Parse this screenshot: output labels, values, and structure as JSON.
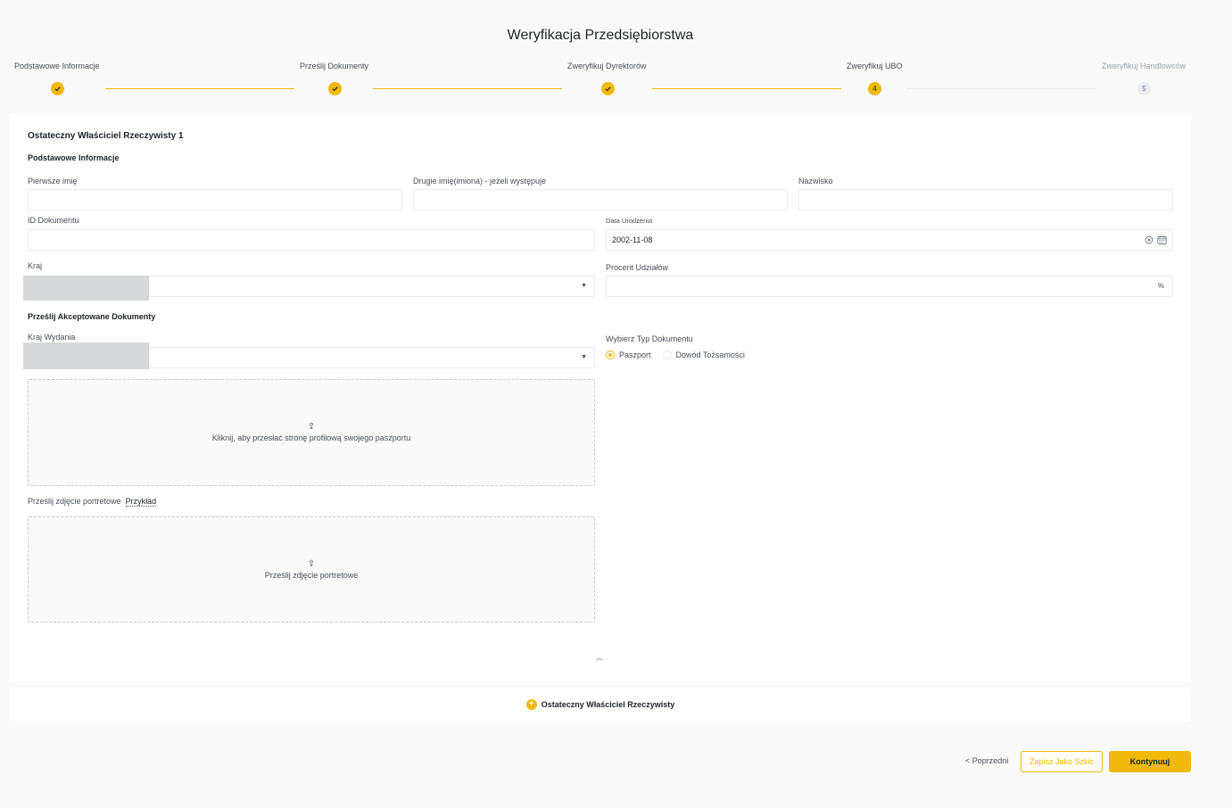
{
  "page": {
    "title": "Weryfikacja Przedsiębiorstwa"
  },
  "stepper": {
    "steps": [
      {
        "label": "Podstawowe Informacje",
        "state": "done"
      },
      {
        "label": "Prześlij Dokumenty",
        "state": "done"
      },
      {
        "label": "Zweryfikuj Dyrektorów",
        "state": "done"
      },
      {
        "label": "Zweryfikuj UBO",
        "state": "current",
        "number": "4"
      },
      {
        "label": "Zweryfikuj Handlowców",
        "state": "pending",
        "number": "5"
      }
    ]
  },
  "ubo": {
    "title": "Ostateczny Właściciel Rzeczywisty 1",
    "basic_section": "Podstawowe Informacje",
    "first_name": {
      "label": "Pierwsze imię",
      "value": ""
    },
    "middle_name": {
      "label": "Drugie imię(imiona) - jeżeli występuje",
      "value": ""
    },
    "last_name": {
      "label": "Nazwisko",
      "value": ""
    },
    "document_id": {
      "label": "ID Dokumentu",
      "value": ""
    },
    "birth_date": {
      "label": "Data Urodzenia",
      "value": "2002-11-08"
    },
    "country": {
      "label": "Kraj",
      "value": ""
    },
    "share_percent": {
      "label": "Procent Udziałów",
      "value": "",
      "suffix": "%"
    },
    "docs_section": "Prześlij Akceptowane Dokumenty",
    "issue_country": {
      "label": "Kraj Wydania",
      "value": ""
    },
    "doc_type": {
      "label": "Wybierz Typ Dokumentu",
      "options": [
        "Paszport",
        "Dowód Tożsamości"
      ],
      "selected": "Paszport"
    },
    "upload_passport": {
      "text": "Kliknij, aby przesłać stronę profilową swojego paszportu"
    },
    "portrait": {
      "label": "Prześlij zdjęcie portretowe",
      "example_link": "Przykład",
      "upload_text": "Prześlij zdjęcie portretowe"
    }
  },
  "add_ubo": {
    "label": "Ostateczny Właściciel Rzeczywisty"
  },
  "footer": {
    "prev_label": "< Poprzedni",
    "draft_label": "Zapisz Jako Szkic",
    "continue_label": "Kontynuuj"
  },
  "colors": {
    "accent": "#f0b90b",
    "text": "#1e2329",
    "muted": "#474d57",
    "border": "#eaecef"
  },
  "icons": [
    "check-icon",
    "clear-icon",
    "calendar-icon",
    "chevron-down-icon",
    "upload-icon",
    "chevron-up-double-icon",
    "plus-circle-icon"
  ]
}
